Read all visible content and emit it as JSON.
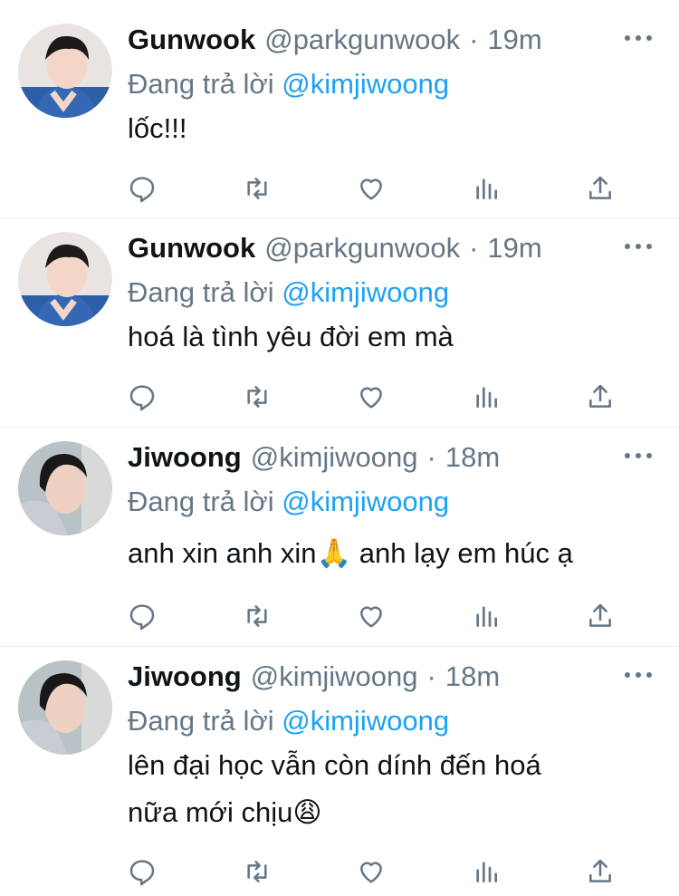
{
  "tweets": [
    {
      "name": "Gunwook",
      "handle": "@parkgunwook",
      "time": "19m",
      "reply_prefix": "Đang trả lời",
      "reply_to": "@kimjiwoong",
      "lines": [
        "lốc!!!"
      ],
      "avatar": "avatar-gunwook"
    },
    {
      "name": "Gunwook",
      "handle": "@parkgunwook",
      "time": "19m",
      "reply_prefix": "Đang trả lời",
      "reply_to": "@kimjiwoong",
      "lines": [
        "hoá là tình yêu đời em mà"
      ],
      "avatar": "avatar-gunwook"
    },
    {
      "name": "Jiwoong",
      "handle": "@kimjiwoong",
      "time": "18m",
      "reply_prefix": "Đang trả lời",
      "reply_to": "@kimjiwoong",
      "lines": [
        "anh xin anh xin🙏 anh lạy em húc ạ"
      ],
      "avatar": "avatar-jiwoong"
    },
    {
      "name": "Jiwoong",
      "handle": "@kimjiwoong",
      "time": "18m",
      "reply_prefix": "Đang trả lời",
      "reply_to": "@kimjiwoong",
      "lines": [
        "lên đại học vẫn còn dính đến hoá",
        "nữa mới chịu😩"
      ],
      "avatar": "avatar-jiwoong"
    }
  ],
  "actions": [
    "reply-icon",
    "retweet-icon",
    "like-icon",
    "analytics-icon",
    "share-icon"
  ],
  "colors": {
    "text": "#0f1419",
    "secondary": "#657786",
    "link": "#1da1f2",
    "divider": "#e6ecf0"
  }
}
